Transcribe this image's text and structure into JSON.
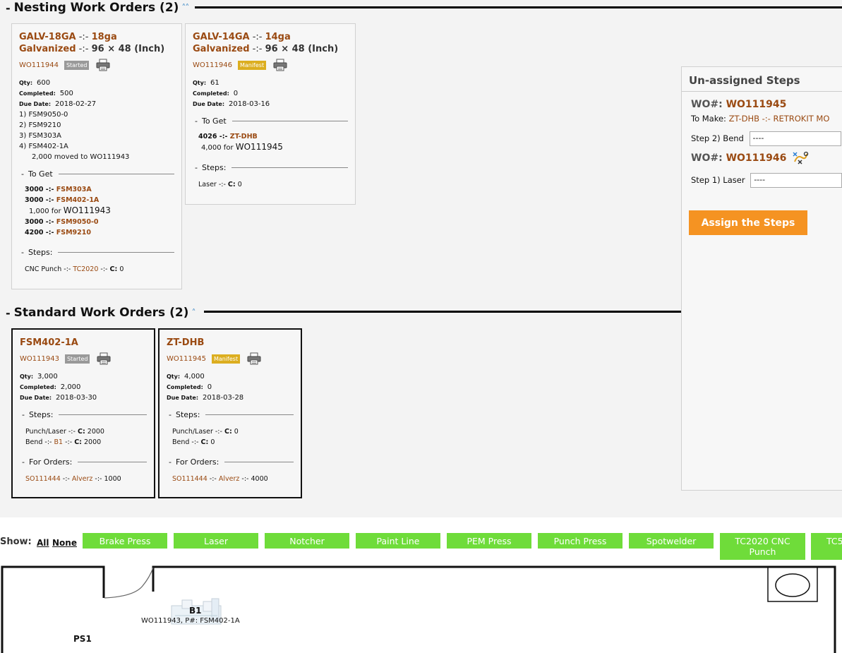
{
  "nesting": {
    "title": "Nesting Work Orders (2)",
    "dash": "-",
    "collapse_icon": "double-chevron-up",
    "cards": [
      {
        "title_line1_code": "GALV-18GA",
        "title_line1_sep": " -:- ",
        "title_line1_val": "18ga",
        "title_line2_mat": "Galvanized",
        "title_line2_sep": " -:- ",
        "title_line2_size": "96 × 48 (Inch)",
        "wo": "WO111944",
        "badge": "Started",
        "qty_label": "Qty:",
        "qty": "600",
        "completed_label": "Completed:",
        "completed": "500",
        "due_label": "Due Date:",
        "due": "2018-02-27",
        "list": [
          "1) FSM9050-0",
          "2) FSM9210",
          "3) FSM303A",
          "4) FSM402-1A"
        ],
        "moved_note": "2,000 moved to WO111943",
        "to_get_label": "To Get",
        "to_get": [
          {
            "qty": "3000",
            "sep": " -:- ",
            "part": "FSM303A"
          },
          {
            "qty": "3000",
            "sep": " -:- ",
            "part": "FSM402-1A"
          },
          {
            "qty": "3000",
            "sep": " -:- ",
            "part": "FSM9050-0"
          },
          {
            "qty": "4200",
            "sep": " -:- ",
            "part": "FSM9210"
          }
        ],
        "to_get_note_qty": "1,000 for",
        "to_get_note_wo": "WO111943",
        "steps_label": "Steps:",
        "step_text": "CNC Punch -:- ",
        "step_machine": "TC2020",
        "step_sep": " -:- ",
        "step_c_label": "C:",
        "step_c": "0"
      },
      {
        "title_line1_code": "GALV-14GA",
        "title_line1_sep": " -:- ",
        "title_line1_val": "14ga",
        "title_line2_mat": "Galvanized",
        "title_line2_sep": " -:- ",
        "title_line2_size": "96 × 48 (Inch)",
        "wo": "WO111946",
        "badge": "Manifest",
        "qty_label": "Qty:",
        "qty": "61",
        "completed_label": "Completed:",
        "completed": "0",
        "due_label": "Due Date:",
        "due": "2018-03-16",
        "to_get_label": "To Get",
        "to_get_qty": "4026",
        "to_get_sep": " -:- ",
        "to_get_part": "ZT-DHB",
        "to_get_note_qty": "4,000 for",
        "to_get_note_wo": "WO111945",
        "steps_label": "Steps:",
        "step_text": "Laser -:- ",
        "step_c_label": "C:",
        "step_c": "0"
      }
    ]
  },
  "standard": {
    "title": "Standard Work Orders (2)",
    "dash": "-",
    "cards": [
      {
        "title": "FSM402-1A",
        "wo": "WO111943",
        "badge": "Started",
        "qty_label": "Qty:",
        "qty": "3,000",
        "completed_label": "Completed:",
        "completed": "2,000",
        "due_label": "Due Date:",
        "due": "2018-03-30",
        "steps_label": "Steps:",
        "step1_text": "Punch/Laser -:- ",
        "step1_c_label": "C:",
        "step1_c": "2000",
        "step2_text": "Bend -:- ",
        "step2_machine": "B1",
        "step2_sep": " -:- ",
        "step2_c_label": "C:",
        "step2_c": "2000",
        "orders_label": "For Orders:",
        "order_so": "SO111444",
        "order_sep": " -:- ",
        "order_customer": "Alverz",
        "order_sep2": " -:- ",
        "order_qty": "1000"
      },
      {
        "title": "ZT-DHB",
        "wo": "WO111945",
        "badge": "Manifest",
        "qty_label": "Qty:",
        "qty": "4,000",
        "completed_label": "Completed:",
        "completed": "0",
        "due_label": "Due Date:",
        "due": "2018-03-28",
        "steps_label": "Steps:",
        "step1_text": "Punch/Laser -:- ",
        "step1_c_label": "C:",
        "step1_c": "0",
        "step2_text": "Bend -:- ",
        "step2_c_label": "C:",
        "step2_c": "0",
        "orders_label": "For Orders:",
        "order_so": "SO111444",
        "order_sep": " -:- ",
        "order_customer": "Alverz",
        "order_sep2": " -:- ",
        "order_qty": "4000"
      }
    ]
  },
  "unassigned": {
    "title": "Un-assigned Steps",
    "wo_label": "WO#:",
    "wo1": "WO111945",
    "to_make_label": "To Make:",
    "to_make_value": "ZT-DHB -:- RETROKIT MO",
    "step2_label": "Step 2) Bend",
    "step2_value": "----",
    "wo2": "WO111946",
    "step1_label": "Step 1) Laser",
    "step1_value": "----",
    "assign_button": "Assign the Steps"
  },
  "filter": {
    "show_label": "Show:",
    "all": "All",
    "none": "None",
    "buttons": [
      "Brake Press",
      "Laser",
      "Notcher",
      "Paint Line",
      "PEM Press",
      "Punch Press",
      "Spotwelder",
      "TC2020 CNC Punch",
      "TC5"
    ]
  },
  "floor": {
    "machine_b1": "B1",
    "b1_job": "WO111943, P#: FSM402-1A",
    "machine_ps1": "PS1"
  },
  "colors": {
    "accent_brown": "#9a4a12",
    "filter_green": "#6fdc3a",
    "assign_orange": "#f59322",
    "badge_started": "#999999",
    "badge_manifest": "#dcae20"
  }
}
